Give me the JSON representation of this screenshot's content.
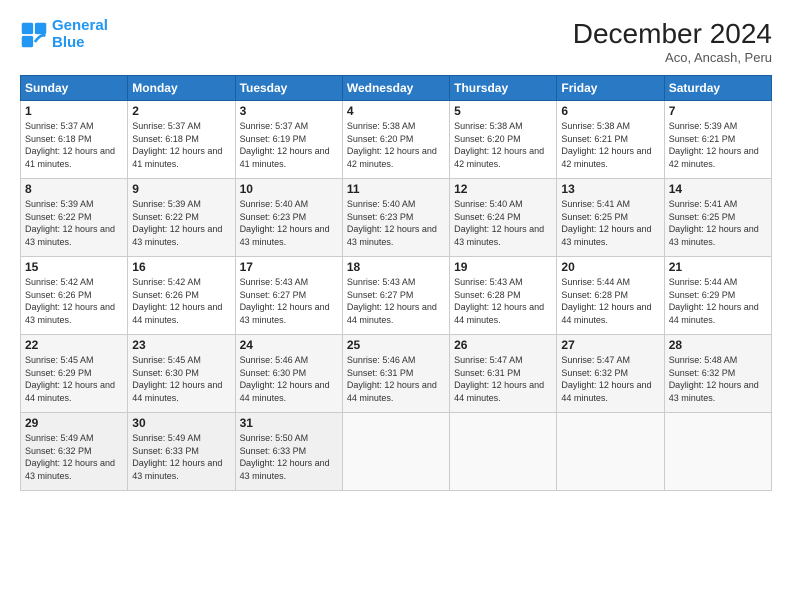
{
  "header": {
    "logo_line1": "General",
    "logo_line2": "Blue",
    "month": "December 2024",
    "location": "Aco, Ancash, Peru"
  },
  "weekdays": [
    "Sunday",
    "Monday",
    "Tuesday",
    "Wednesday",
    "Thursday",
    "Friday",
    "Saturday"
  ],
  "weeks": [
    [
      {
        "day": "1",
        "sunrise": "5:37 AM",
        "sunset": "6:18 PM",
        "daylight": "12 hours and 41 minutes."
      },
      {
        "day": "2",
        "sunrise": "5:37 AM",
        "sunset": "6:18 PM",
        "daylight": "12 hours and 41 minutes."
      },
      {
        "day": "3",
        "sunrise": "5:37 AM",
        "sunset": "6:19 PM",
        "daylight": "12 hours and 41 minutes."
      },
      {
        "day": "4",
        "sunrise": "5:38 AM",
        "sunset": "6:20 PM",
        "daylight": "12 hours and 42 minutes."
      },
      {
        "day": "5",
        "sunrise": "5:38 AM",
        "sunset": "6:20 PM",
        "daylight": "12 hours and 42 minutes."
      },
      {
        "day": "6",
        "sunrise": "5:38 AM",
        "sunset": "6:21 PM",
        "daylight": "12 hours and 42 minutes."
      },
      {
        "day": "7",
        "sunrise": "5:39 AM",
        "sunset": "6:21 PM",
        "daylight": "12 hours and 42 minutes."
      }
    ],
    [
      {
        "day": "8",
        "sunrise": "5:39 AM",
        "sunset": "6:22 PM",
        "daylight": "12 hours and 43 minutes."
      },
      {
        "day": "9",
        "sunrise": "5:39 AM",
        "sunset": "6:22 PM",
        "daylight": "12 hours and 43 minutes."
      },
      {
        "day": "10",
        "sunrise": "5:40 AM",
        "sunset": "6:23 PM",
        "daylight": "12 hours and 43 minutes."
      },
      {
        "day": "11",
        "sunrise": "5:40 AM",
        "sunset": "6:23 PM",
        "daylight": "12 hours and 43 minutes."
      },
      {
        "day": "12",
        "sunrise": "5:40 AM",
        "sunset": "6:24 PM",
        "daylight": "12 hours and 43 minutes."
      },
      {
        "day": "13",
        "sunrise": "5:41 AM",
        "sunset": "6:25 PM",
        "daylight": "12 hours and 43 minutes."
      },
      {
        "day": "14",
        "sunrise": "5:41 AM",
        "sunset": "6:25 PM",
        "daylight": "12 hours and 43 minutes."
      }
    ],
    [
      {
        "day": "15",
        "sunrise": "5:42 AM",
        "sunset": "6:26 PM",
        "daylight": "12 hours and 43 minutes."
      },
      {
        "day": "16",
        "sunrise": "5:42 AM",
        "sunset": "6:26 PM",
        "daylight": "12 hours and 44 minutes."
      },
      {
        "day": "17",
        "sunrise": "5:43 AM",
        "sunset": "6:27 PM",
        "daylight": "12 hours and 43 minutes."
      },
      {
        "day": "18",
        "sunrise": "5:43 AM",
        "sunset": "6:27 PM",
        "daylight": "12 hours and 44 minutes."
      },
      {
        "day": "19",
        "sunrise": "5:43 AM",
        "sunset": "6:28 PM",
        "daylight": "12 hours and 44 minutes."
      },
      {
        "day": "20",
        "sunrise": "5:44 AM",
        "sunset": "6:28 PM",
        "daylight": "12 hours and 44 minutes."
      },
      {
        "day": "21",
        "sunrise": "5:44 AM",
        "sunset": "6:29 PM",
        "daylight": "12 hours and 44 minutes."
      }
    ],
    [
      {
        "day": "22",
        "sunrise": "5:45 AM",
        "sunset": "6:29 PM",
        "daylight": "12 hours and 44 minutes."
      },
      {
        "day": "23",
        "sunrise": "5:45 AM",
        "sunset": "6:30 PM",
        "daylight": "12 hours and 44 minutes."
      },
      {
        "day": "24",
        "sunrise": "5:46 AM",
        "sunset": "6:30 PM",
        "daylight": "12 hours and 44 minutes."
      },
      {
        "day": "25",
        "sunrise": "5:46 AM",
        "sunset": "6:31 PM",
        "daylight": "12 hours and 44 minutes."
      },
      {
        "day": "26",
        "sunrise": "5:47 AM",
        "sunset": "6:31 PM",
        "daylight": "12 hours and 44 minutes."
      },
      {
        "day": "27",
        "sunrise": "5:47 AM",
        "sunset": "6:32 PM",
        "daylight": "12 hours and 44 minutes."
      },
      {
        "day": "28",
        "sunrise": "5:48 AM",
        "sunset": "6:32 PM",
        "daylight": "12 hours and 43 minutes."
      }
    ],
    [
      {
        "day": "29",
        "sunrise": "5:49 AM",
        "sunset": "6:32 PM",
        "daylight": "12 hours and 43 minutes."
      },
      {
        "day": "30",
        "sunrise": "5:49 AM",
        "sunset": "6:33 PM",
        "daylight": "12 hours and 43 minutes."
      },
      {
        "day": "31",
        "sunrise": "5:50 AM",
        "sunset": "6:33 PM",
        "daylight": "12 hours and 43 minutes."
      },
      null,
      null,
      null,
      null
    ]
  ]
}
